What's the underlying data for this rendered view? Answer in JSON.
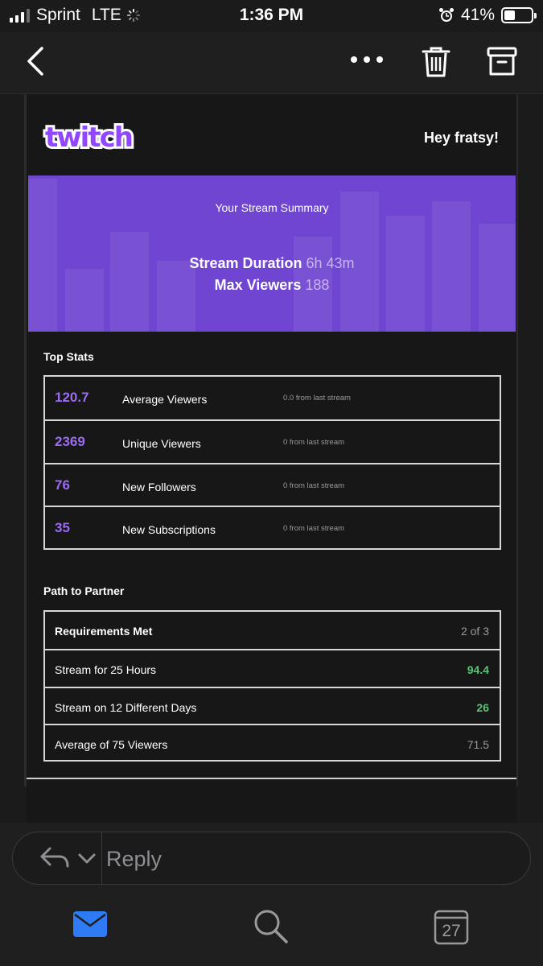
{
  "status_bar": {
    "carrier": "Sprint",
    "network": "LTE",
    "time": "1:36 PM",
    "battery_percent": "41%",
    "battery_level": 0.41
  },
  "nav": {
    "icons": [
      "back-icon",
      "more-icon",
      "trash-icon",
      "archive-icon"
    ]
  },
  "email": {
    "logo_text": "twitch",
    "greeting": "Hey fratsy!",
    "banner": {
      "title": "Your Stream Summary",
      "duration_label": "Stream Duration",
      "duration_value": "6h 43m",
      "viewers_label": "Max Viewers",
      "viewers_value": "188"
    },
    "top_stats": {
      "title": "Top Stats",
      "rows": [
        {
          "value": "120.7",
          "label": "Average Viewers",
          "delta": "0.0 from last stream"
        },
        {
          "value": "2369",
          "label": "Unique Viewers",
          "delta": "0 from last stream"
        },
        {
          "value": "76",
          "label": "New Followers",
          "delta": "0 from last stream"
        },
        {
          "value": "35",
          "label": "New Subscriptions",
          "delta": "0 from last stream"
        }
      ]
    },
    "partner": {
      "title": "Path to Partner",
      "rows": [
        {
          "label": "Requirements Met",
          "value": "2 of 3"
        },
        {
          "label": "Stream for 25 Hours",
          "value": "94.4"
        },
        {
          "label": "Stream on 12 Different Days",
          "value": "26"
        },
        {
          "label": "Average of 75 Viewers",
          "value": "71.5"
        }
      ]
    }
  },
  "reply": {
    "placeholder": "Reply"
  },
  "tab_bar": {
    "calendar_day": "27"
  },
  "colors": {
    "accent_purple": "#9b6cf0",
    "banner_purple": "#6f45d1",
    "success_green": "#5cc274",
    "mail_blue": "#2f7bf5"
  }
}
